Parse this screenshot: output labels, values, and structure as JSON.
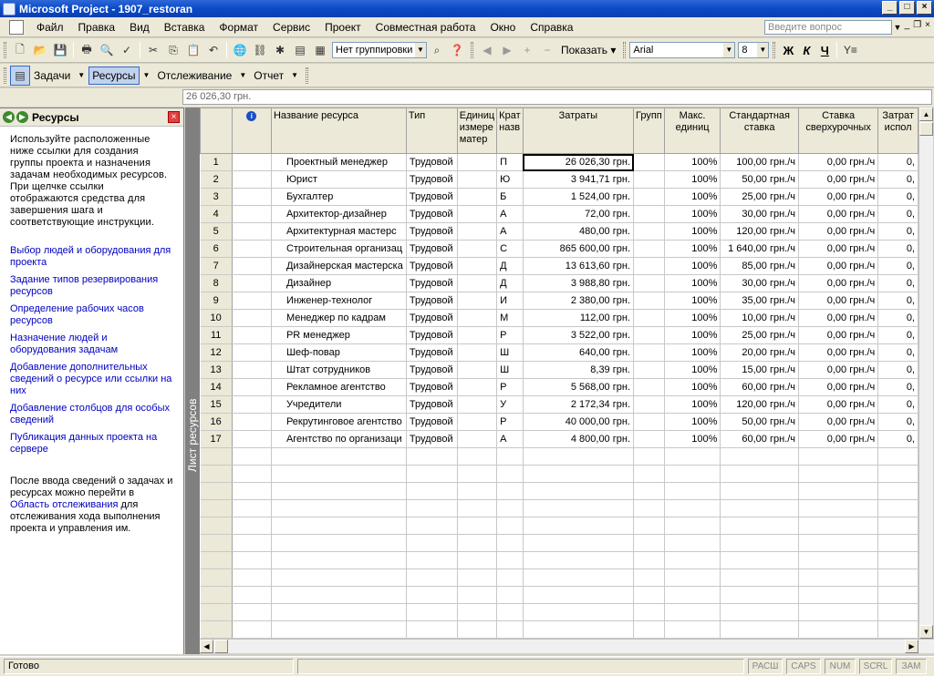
{
  "window": {
    "title": "Microsoft Project - 1907_restoran"
  },
  "menu": {
    "items": [
      "Файл",
      "Правка",
      "Вид",
      "Вставка",
      "Формат",
      "Сервис",
      "Проект",
      "Совместная работа",
      "Окно",
      "Справка"
    ],
    "help_placeholder": "Введите вопрос"
  },
  "toolbar": {
    "grouping": "Нет группировки",
    "show_label": "Показать",
    "font": "Arial",
    "font_size": "8",
    "bold": "Ж",
    "italic": "К",
    "underline": "Ч"
  },
  "guide": {
    "tasks": "Задачи",
    "resources": "Ресурсы",
    "tracking": "Отслеживание",
    "report": "Отчет"
  },
  "entry_bar": {
    "value": "26 026,30 грн."
  },
  "side_pane": {
    "title": "Ресурсы",
    "intro": "Используйте расположенные ниже ссылки для создания группы проекта и назначения задачам необходимых ресурсов. При щелчке ссылки отображаются средства для завершения шага и соответствующие инструкции.",
    "links": [
      "Выбор людей и оборудования для проекта",
      "Задание типов резервирования ресурсов",
      "Определение рабочих часов ресурсов",
      "Назначение людей и оборудования задачам",
      "Добавление дополнительных сведений о ресурсе или ссылки на них",
      "Добавление столбцов для особых сведений",
      "Публикация данных проекта на сервере"
    ],
    "outro_pre": "После ввода сведений о задачах и ресурсах можно перейти в ",
    "outro_link": "Область отслеживания",
    "outro_post": " для отслеживания хода выполнения проекта и управления им."
  },
  "view_bar": {
    "label": "Лист ресурсов"
  },
  "sheet": {
    "columns": [
      "",
      "",
      "Название ресурса",
      "Тип",
      "Единиц измере матер",
      "Крат назв",
      "Затраты",
      "Групп",
      "Макс. единиц",
      "Стандартная ставка",
      "Ставка сверхурочных",
      "Затрат испол"
    ],
    "rows": [
      {
        "n": "1",
        "name": "Проектный менеджер",
        "type": "Трудовой",
        "short": "П",
        "cost": "26 026,30 грн.",
        "max": "100%",
        "std": "100,00 грн./ч",
        "ovt": "0,00 грн./ч",
        "use": "0,"
      },
      {
        "n": "2",
        "name": "Юрист",
        "type": "Трудовой",
        "short": "Ю",
        "cost": "3 941,71 грн.",
        "max": "100%",
        "std": "50,00 грн./ч",
        "ovt": "0,00 грн./ч",
        "use": "0,"
      },
      {
        "n": "3",
        "name": "Бухгалтер",
        "type": "Трудовой",
        "short": "Б",
        "cost": "1 524,00 грн.",
        "max": "100%",
        "std": "25,00 грн./ч",
        "ovt": "0,00 грн./ч",
        "use": "0,"
      },
      {
        "n": "4",
        "name": "Архитектор-дизайнер",
        "type": "Трудовой",
        "short": "А",
        "cost": "72,00 грн.",
        "max": "100%",
        "std": "30,00 грн./ч",
        "ovt": "0,00 грн./ч",
        "use": "0,"
      },
      {
        "n": "5",
        "name": "Архитектурная мастерс",
        "type": "Трудовой",
        "short": "А",
        "cost": "480,00 грн.",
        "max": "100%",
        "std": "120,00 грн./ч",
        "ovt": "0,00 грн./ч",
        "use": "0,"
      },
      {
        "n": "6",
        "name": "Строительная организац",
        "type": "Трудовой",
        "short": "С",
        "cost": "865 600,00 грн.",
        "max": "100%",
        "std": "1 640,00 грн./ч",
        "ovt": "0,00 грн./ч",
        "use": "0,"
      },
      {
        "n": "7",
        "name": "Дизайнерская мастерска",
        "type": "Трудовой",
        "short": "Д",
        "cost": "13 613,60 грн.",
        "max": "100%",
        "std": "85,00 грн./ч",
        "ovt": "0,00 грн./ч",
        "use": "0,"
      },
      {
        "n": "8",
        "name": "Дизайнер",
        "type": "Трудовой",
        "short": "Д",
        "cost": "3 988,80 грн.",
        "max": "100%",
        "std": "30,00 грн./ч",
        "ovt": "0,00 грн./ч",
        "use": "0,"
      },
      {
        "n": "9",
        "name": "Инженер-технолог",
        "type": "Трудовой",
        "short": "И",
        "cost": "2 380,00 грн.",
        "max": "100%",
        "std": "35,00 грн./ч",
        "ovt": "0,00 грн./ч",
        "use": "0,"
      },
      {
        "n": "10",
        "name": "Менеджер по кадрам",
        "type": "Трудовой",
        "short": "М",
        "cost": "112,00 грн.",
        "max": "100%",
        "std": "10,00 грн./ч",
        "ovt": "0,00 грн./ч",
        "use": "0,"
      },
      {
        "n": "11",
        "name": "PR менеджер",
        "type": "Трудовой",
        "short": "Р",
        "cost": "3 522,00 грн.",
        "max": "100%",
        "std": "25,00 грн./ч",
        "ovt": "0,00 грн./ч",
        "use": "0,"
      },
      {
        "n": "12",
        "name": "Шеф-повар",
        "type": "Трудовой",
        "short": "Ш",
        "cost": "640,00 грн.",
        "max": "100%",
        "std": "20,00 грн./ч",
        "ovt": "0,00 грн./ч",
        "use": "0,"
      },
      {
        "n": "13",
        "name": "Штат сотрудников",
        "type": "Трудовой",
        "short": "Ш",
        "cost": "8,39 грн.",
        "max": "100%",
        "std": "15,00 грн./ч",
        "ovt": "0,00 грн./ч",
        "use": "0,"
      },
      {
        "n": "14",
        "name": "Рекламное агентство",
        "type": "Трудовой",
        "short": "Р",
        "cost": "5 568,00 грн.",
        "max": "100%",
        "std": "60,00 грн./ч",
        "ovt": "0,00 грн./ч",
        "use": "0,"
      },
      {
        "n": "15",
        "name": "Учредители",
        "type": "Трудовой",
        "short": "У",
        "cost": "2 172,34 грн.",
        "max": "100%",
        "std": "120,00 грн./ч",
        "ovt": "0,00 грн./ч",
        "use": "0,"
      },
      {
        "n": "16",
        "name": "Рекрутинговое агентство",
        "type": "Трудовой",
        "short": "Р",
        "cost": "40 000,00 грн.",
        "max": "100%",
        "std": "50,00 грн./ч",
        "ovt": "0,00 грн./ч",
        "use": "0,"
      },
      {
        "n": "17",
        "name": "Агентство по организаци",
        "type": "Трудовой",
        "short": "А",
        "cost": "4 800,00 грн.",
        "max": "100%",
        "std": "60,00 грн./ч",
        "ovt": "0,00 грн./ч",
        "use": "0,"
      }
    ]
  },
  "status": {
    "text": "Готово",
    "indicators": [
      "РАСШ",
      "CAPS",
      "NUM",
      "SCRL",
      "ЗАМ"
    ]
  }
}
